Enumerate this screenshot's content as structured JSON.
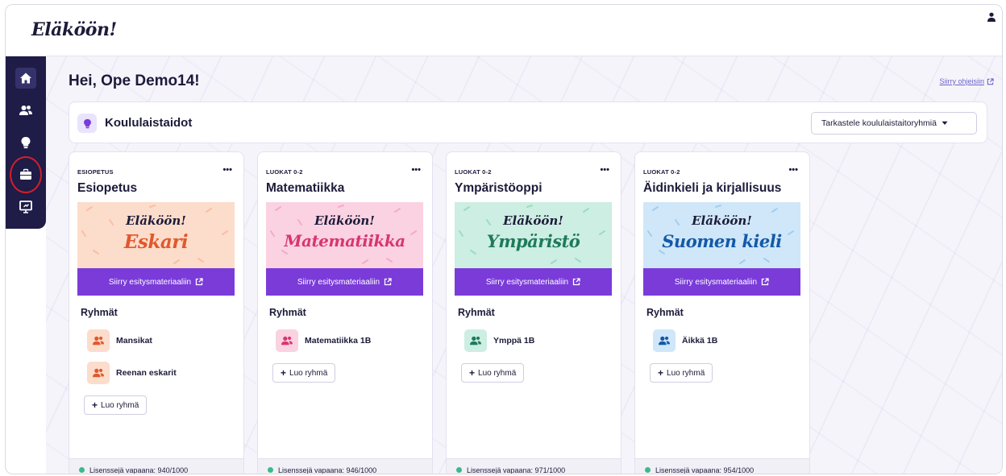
{
  "app": {
    "logo": "Eläköön!"
  },
  "sidebar": {
    "items": [
      {
        "icon": "home-icon",
        "active": true
      },
      {
        "icon": "users-icon",
        "active": false
      },
      {
        "icon": "lightbulb-icon",
        "active": false
      },
      {
        "icon": "briefcase-icon",
        "active": false,
        "highlighted": true
      },
      {
        "icon": "presentation-icon",
        "active": false
      }
    ]
  },
  "main": {
    "greeting": "Hei, Ope Demo14!",
    "help_link": "Siirry ohjeisiin",
    "skills": {
      "title": "Koululaistaidot",
      "button": "Tarkastele koululaistaitoryhmiä"
    },
    "cards": [
      {
        "grade": "ESIOPETUS",
        "title": "Esiopetus",
        "banner_brand": "Eläköön!",
        "banner_subject": "Eskari",
        "material_button": "Siirry esitysmateriaaliin",
        "groups_heading": "Ryhmät",
        "groups": [
          "Mansikat",
          "Reenan eskarit"
        ],
        "create_button": "Luo ryhmä",
        "license": "Lisenssejä vapaana: 940/1000"
      },
      {
        "grade": "LUOKAT 0-2",
        "title": "Matematiikka",
        "banner_brand": "Eläköön!",
        "banner_subject": "Matematiikka",
        "material_button": "Siirry esitysmateriaaliin",
        "groups_heading": "Ryhmät",
        "groups": [
          "Matematiikka 1B"
        ],
        "create_button": "Luo ryhmä",
        "license": "Lisenssejä vapaana: 946/1000"
      },
      {
        "grade": "LUOKAT 0-2",
        "title": "Ympäristöoppi",
        "banner_brand": "Eläköön!",
        "banner_subject": "Ympäristö",
        "material_button": "Siirry esitysmateriaaliin",
        "groups_heading": "Ryhmät",
        "groups": [
          "Ymppä 1B"
        ],
        "create_button": "Luo ryhmä",
        "license": "Lisenssejä vapaana: 971/1000"
      },
      {
        "grade": "LUOKAT 0-2",
        "title": "Äidinkieli ja kirjallisuus",
        "banner_brand": "Eläköön!",
        "banner_subject": "Suomen kieli",
        "material_button": "Siirry esitysmateriaaliin",
        "groups_heading": "Ryhmät",
        "groups": [
          "Äikkä 1B"
        ],
        "create_button": "Luo ryhmä",
        "license": "Lisenssejä vapaana: 954/1000"
      }
    ]
  },
  "colors": {
    "sidebar_bg": "#1f1c47",
    "primary_button": "#7a3bd9",
    "highlight_ring": "#d21f2b",
    "license_dot": "#3cb98a",
    "eskari_banner": "#fcdccb",
    "eskari_text": "#e0582c",
    "matematiikka_banner": "#fad2e2",
    "matematiikka_text": "#d9356f",
    "ymparisto_banner": "#cdeee2",
    "ymparisto_text": "#1e7a5c",
    "suomi_banner": "#cfe7f8",
    "suomi_text": "#1459a8"
  }
}
